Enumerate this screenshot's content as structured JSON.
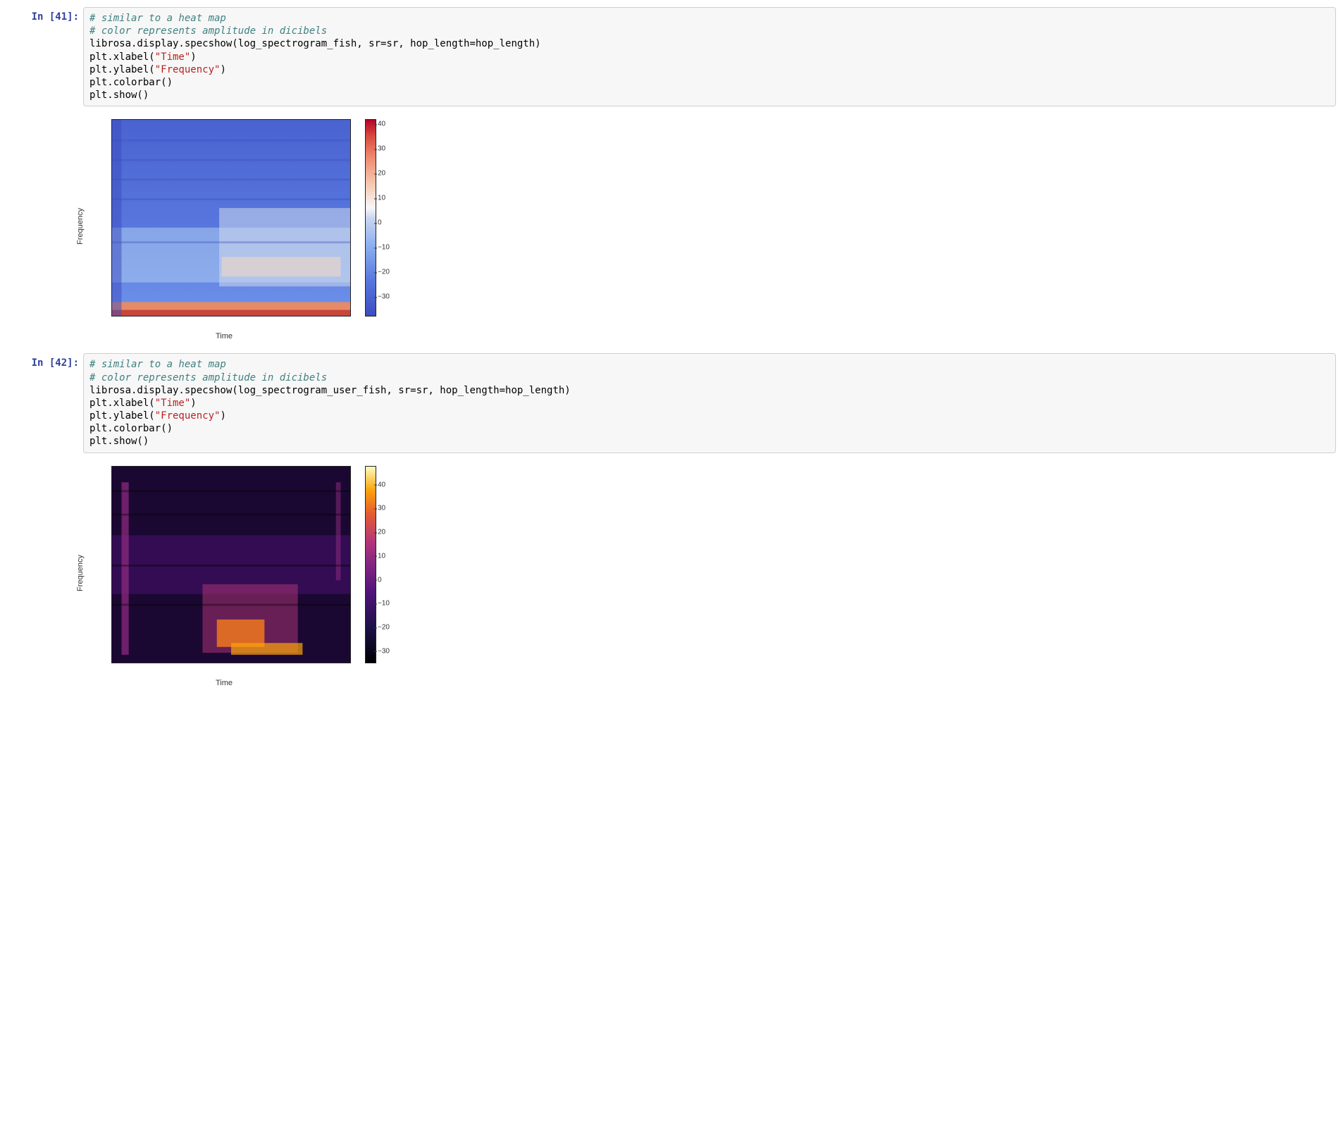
{
  "cells": [
    {
      "prompt_prefix": "In [",
      "prompt_num": "41",
      "prompt_suffix": "]:",
      "code": {
        "comment1": "# similar to a heat map",
        "comment2": "# color represents amplitude in dicibels",
        "line3_a": "librosa.display.specshow(log_spectrogram_fish, sr=sr, hop_length=hop_length)",
        "line4_a": "plt.xlabel(",
        "line4_str": "\"Time\"",
        "line4_b": ")",
        "line5_a": "plt.ylabel(",
        "line5_str": "\"Frequency\"",
        "line5_b": ")",
        "line6": "plt.colorbar()",
        "line7": "plt.show()"
      },
      "chart": {
        "xlabel": "Time",
        "ylabel": "Frequency",
        "colorbar_ticks": [
          40,
          30,
          20,
          10,
          0,
          -10,
          -20,
          -30
        ],
        "colorbar_range": [
          -38,
          42
        ]
      }
    },
    {
      "prompt_prefix": "In [",
      "prompt_num": "42",
      "prompt_suffix": "]:",
      "code": {
        "comment1": "# similar to a heat map",
        "comment2": "# color represents amplitude in dicibels",
        "line3_a": "librosa.display.specshow(log_spectrogram_user_fish, sr=sr, hop_length=hop_length)",
        "line4_a": "plt.xlabel(",
        "line4_str": "\"Time\"",
        "line4_b": ")",
        "line5_a": "plt.ylabel(",
        "line5_str": "\"Frequency\"",
        "line5_b": ")",
        "line6": "plt.colorbar()",
        "line7": "plt.show()"
      },
      "chart": {
        "xlabel": "Time",
        "ylabel": "Frequency",
        "colorbar_ticks": [
          40,
          30,
          20,
          10,
          0,
          -10,
          -20,
          -30
        ],
        "colorbar_range": [
          -35,
          48
        ]
      }
    }
  ],
  "chart_data": [
    {
      "type": "heatmap",
      "title": "",
      "xlabel": "Time",
      "ylabel": "Frequency",
      "colormap": "coolwarm",
      "value_range_db": [
        -38,
        42
      ],
      "colorbar_ticks": [
        40,
        30,
        20,
        10,
        0,
        -10,
        -20,
        -30
      ],
      "description": "Log spectrogram (log_spectrogram_fish). Predominantly blue (≈ -10 to -30 dB) across most of the frequency-time plane. Light/white horizontal bands (≈ -5 to +5 dB) in the low–mid frequency region, stronger in the second half of the time axis. A narrow warm-red band (≈ +20 to +40 dB) along the very bottom (lowest frequencies)."
    },
    {
      "type": "heatmap",
      "title": "",
      "xlabel": "Time",
      "ylabel": "Frequency",
      "colormap": "magma",
      "value_range_db": [
        -35,
        48
      ],
      "colorbar_ticks": [
        40,
        30,
        20,
        10,
        0,
        -10,
        -20,
        -30
      ],
      "description": "Log spectrogram (log_spectrogram_user_fish). Mostly very dark purple/black (≈ -20 to -30 dB) over the full field. Brighter magenta/orange structure (≈ +10 to +30 dB) concentrated in the lower frequencies during the middle-to-late time region, with a thin bright streak near the left edge and a faint one near the right edge."
    }
  ]
}
